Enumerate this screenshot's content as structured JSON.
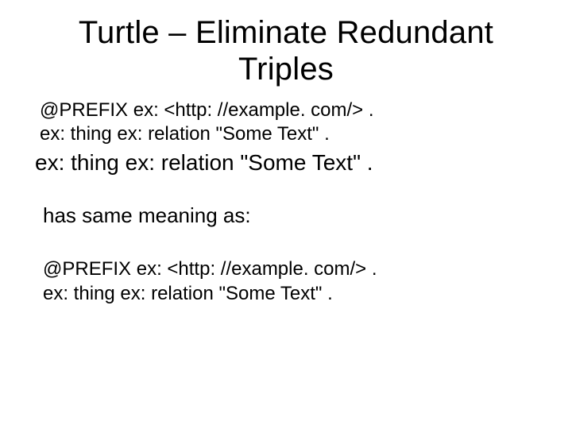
{
  "title_line1": "Turtle – Eliminate Redundant",
  "title_line2": "Triples",
  "code1_line1": "@PREFIX ex: <http: //example. com/> .",
  "code1_line2": "ex: thing ex: relation \"Some Text\" .",
  "code2_line1": "ex: thing ex: relation \"Some Text\" .",
  "mid_text": "has same meaning as:",
  "code3_line1": "@PREFIX ex: <http: //example. com/> .",
  "code3_line2": "ex: thing ex: relation \"Some Text\" ."
}
